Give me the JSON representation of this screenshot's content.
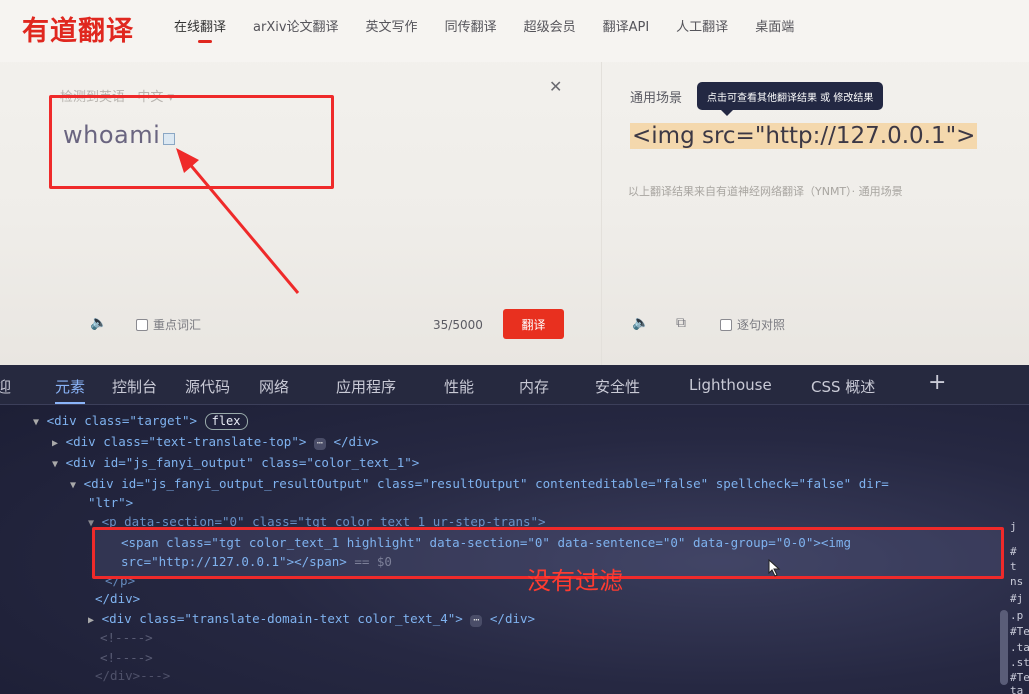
{
  "header": {
    "logo": "有道翻译",
    "nav": [
      "在线翻译",
      "arXiv论文翻译",
      "英文写作",
      "同传翻译",
      "超级会员",
      "翻译API",
      "人工翻译",
      "桌面端"
    ],
    "active_nav": "在线翻译"
  },
  "source": {
    "lang_row": "检测到英语 · 中文 ▾",
    "text": "whoami",
    "counter": "35/5000",
    "key_words_label": "重点词汇",
    "translate_button": "翻译"
  },
  "target": {
    "scene_label": "通用场景",
    "tooltip": "点击可查看其他翻译结果 或 修改结果",
    "text": "<img src=\"http://127.0.0.1\">",
    "source_note": "以上翻译结果来自有道神经网络翻译（YNMT）· 通用场景",
    "sentence_align_label": "逐句对照"
  },
  "devtools": {
    "tabs": [
      "迎",
      "元素",
      "控制台",
      "源代码",
      "网络",
      "应用程序",
      "性能",
      "内存",
      "安全性",
      "Lighthouse",
      "CSS 概述",
      "+"
    ],
    "active_tab": "元素",
    "flex_badge": "flex",
    "dom_lines": {
      "l1_tag": "<div class=\"target\">",
      "l2": "<div class=\"text-translate-top\">",
      "l2_end": "</div>",
      "l3": "<div id=\"js_fanyi_output\" class=\"color_text_1\">",
      "l4": "<div id=\"js_fanyi_output_resultOutput\" class=\"resultOutput\" contenteditable=\"false\" spellcheck=\"false\" dir=",
      "l4b": "\"ltr\">",
      "l5": "<p data-section=\"0\" class=\"tgt color_text_1 ur-step-trans\">",
      "l6a": "<span class=\"tgt color_text_1 highlight\" data-section=\"0\" data-sentence=\"0\" data-group=\"0-0\"><img",
      "l6b": "src=\"http://127.0.0.1\"></span>",
      "l6b_eq": "== $0",
      "l7": "</p>",
      "l8": "</div>",
      "l9": "<div class=\"translate-domain-text color_text_4\">",
      "l9_end": "</div>",
      "l10": "<!---->",
      "l11": "<!---->",
      "l12": "</div>--->"
    },
    "side_fragments": [
      "j",
      "#",
      "t",
      "ns",
      "#j",
      ".p",
      "#Te",
      ".ta",
      ".st",
      "#Te",
      "ta"
    ]
  },
  "annotation": "没有过滤",
  "colors": {
    "brand_red": "#e0271f",
    "annotation_red": "#ef2a2a",
    "devtools_bg": "#262842"
  }
}
